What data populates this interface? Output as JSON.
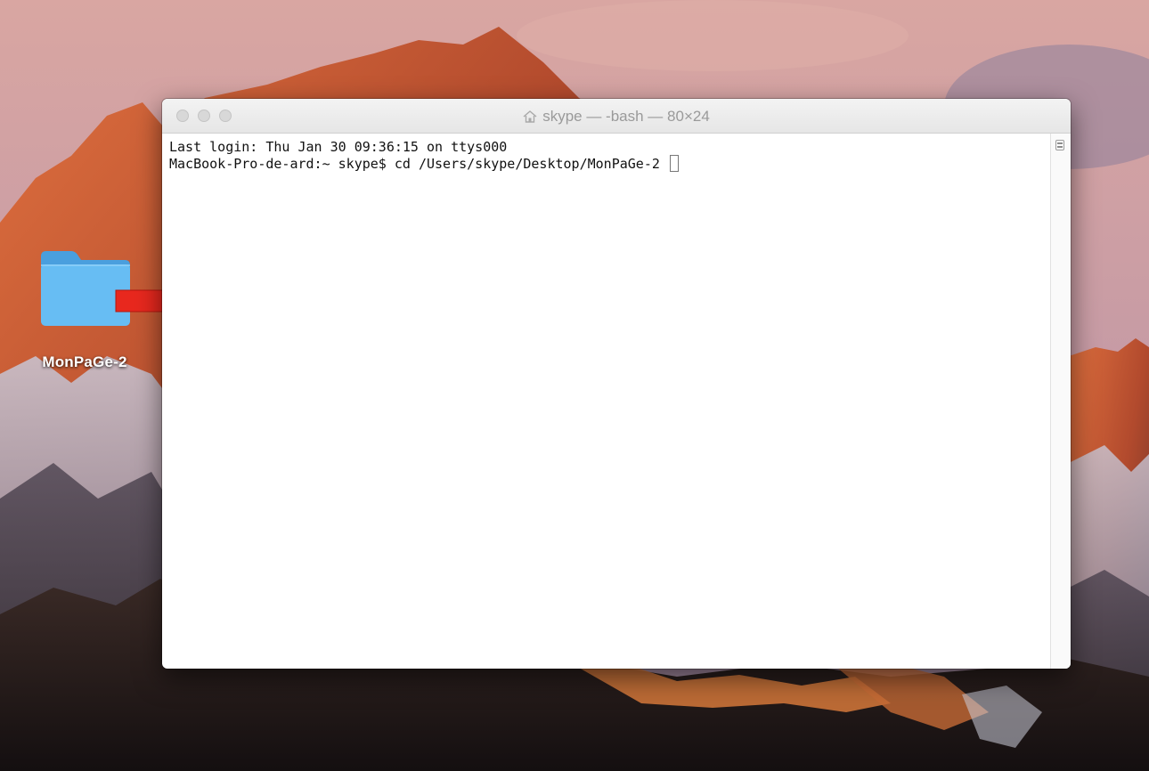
{
  "desktop": {
    "folder": {
      "label": "MonPaGe-2",
      "icon": "folder-icon"
    },
    "annotation": {
      "icon": "red-arrow-icon",
      "color": "#e8281e"
    }
  },
  "terminal": {
    "title": "skype — -bash — 80×24",
    "title_icon": "home-icon",
    "lines": [
      "Last login: Thu Jan 30 09:36:15 on ttys000",
      "MacBook-Pro-de-ard:~ skype$ cd /Users/skype/Desktop/MonPaGe-2 "
    ],
    "scroll_icon": "scroll-marker-icon"
  }
}
